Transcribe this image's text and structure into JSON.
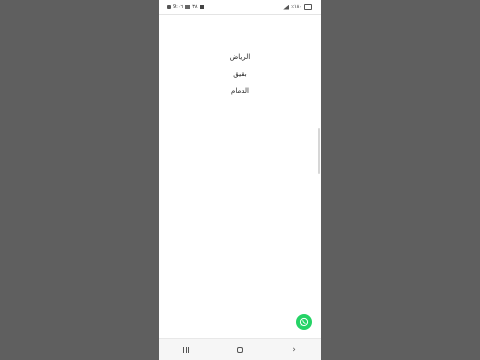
{
  "status_bar": {
    "left_text": "9:٠٦",
    "notification_count": "٣٨",
    "right_text": "٪١٨٠"
  },
  "cities": [
    {
      "label": "الرياض"
    },
    {
      "label": "بقيق"
    },
    {
      "label": "الدمام"
    }
  ],
  "floating_button": {
    "icon": "whatsapp-icon",
    "color": "#25d366"
  },
  "nav_bar": {
    "icons": [
      "recents-icon",
      "home-icon",
      "back-icon"
    ]
  }
}
